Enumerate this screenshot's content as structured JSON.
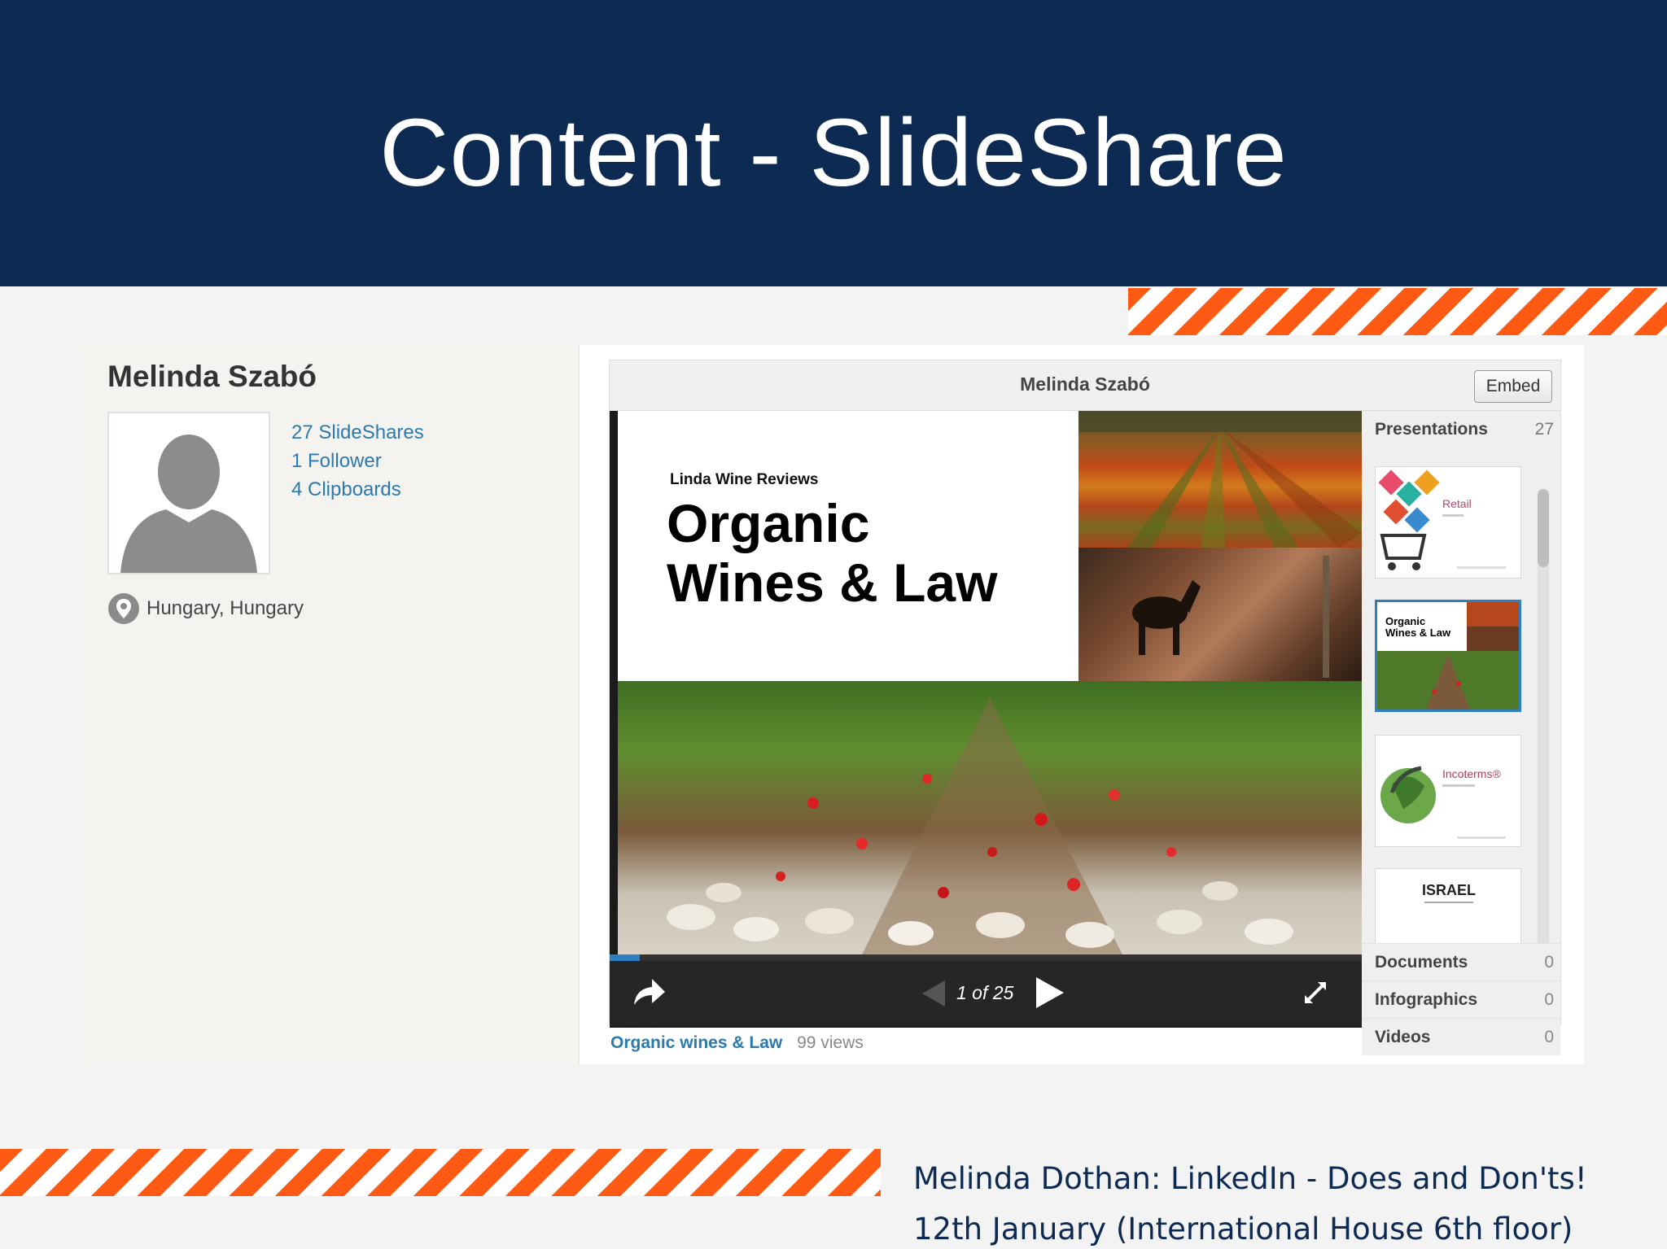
{
  "slide_title": "Content - SlideShare",
  "profile": {
    "name": "Melinda Szabó",
    "stats": [
      "27 SlideShares",
      "1 Follower",
      "4 Clipboards"
    ],
    "location": "Hungary, Hungary"
  },
  "player": {
    "author": "Melinda Szabó",
    "embed_label": "Embed",
    "slide": {
      "brand": "Linda Wine Reviews",
      "title_line1": "Organic",
      "title_line2": "Wines & Law"
    },
    "page_counter": "1 of 25",
    "progress_fraction": 0.04,
    "sidebar": {
      "presentations_label": "Presentations",
      "presentations_count": "27",
      "thumbnails": [
        {
          "text": "Retail",
          "active": false
        },
        {
          "text": "Organic Wines & Law",
          "active": true
        },
        {
          "text": "Incoterms®",
          "active": false
        },
        {
          "text": "ISRAEL",
          "active": false
        }
      ],
      "categories": [
        {
          "label": "Documents",
          "count": "0"
        },
        {
          "label": "Infographics",
          "count": "0"
        },
        {
          "label": "Videos",
          "count": "0"
        }
      ]
    }
  },
  "caption": {
    "title": "Organic wines & Law",
    "views": "99 views"
  },
  "footer": {
    "line1": "Melinda Dothan: LinkedIn - Does and Don'ts!",
    "line2": "12th January (International House 6th floor)"
  },
  "colors": {
    "header_bg": "#0d2a52",
    "stripe_orange": "#ff5a14",
    "link_blue": "#2a7ab0",
    "active_blue": "#2d7fc1"
  }
}
